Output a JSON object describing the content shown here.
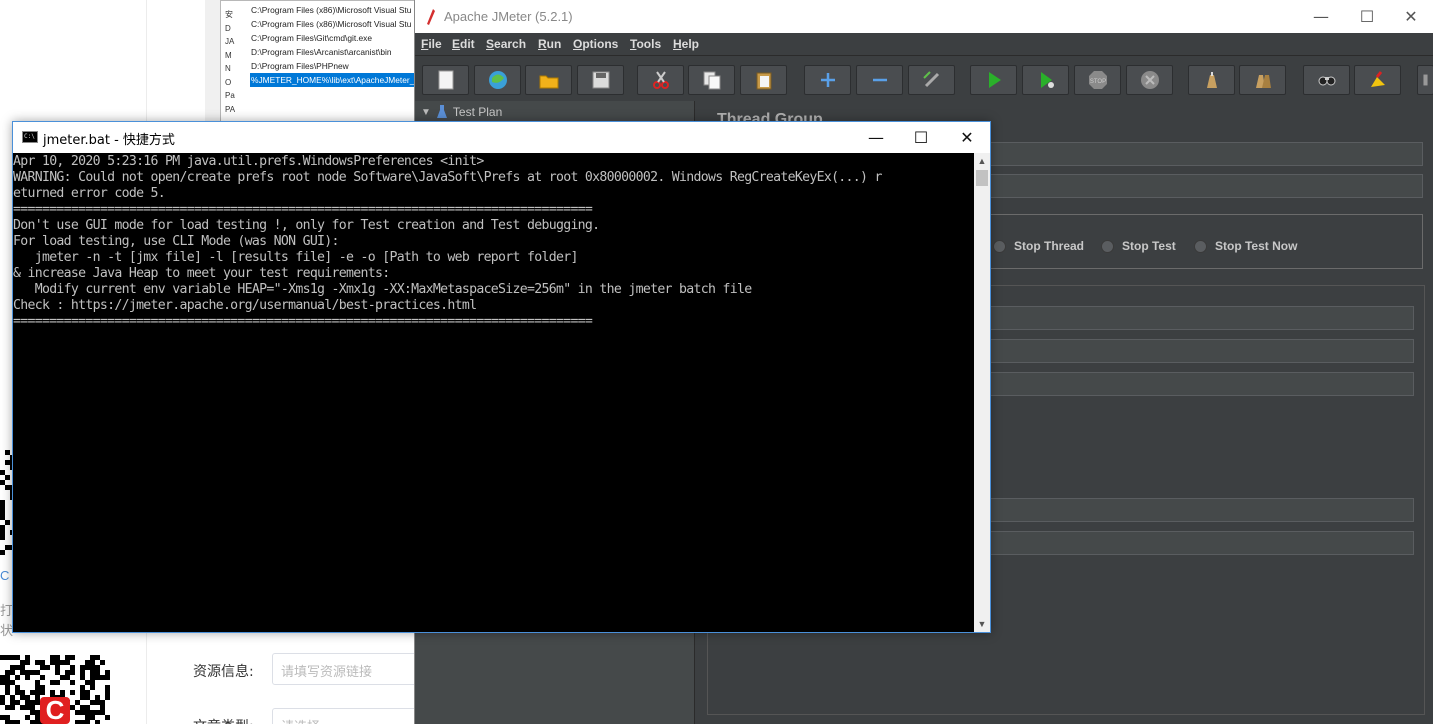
{
  "background_page": {
    "side_text_1": "C",
    "side_text_2": "打",
    "side_text_3": "状",
    "resource_label": "资源信息:",
    "resource_placeholder": "请填写资源链接",
    "article_type_label": "文章类型:",
    "article_type_placeholder": "请选择"
  },
  "path_dialog": {
    "left_labels": [
      "安",
      "D",
      "JA",
      "M",
      "N",
      "O",
      "Pa",
      "PA"
    ],
    "paths": [
      "C:\\Program Files (x86)\\Microsoft Visual Stu",
      "C:\\Program Files (x86)\\Microsoft Visual Stu",
      "C:\\Program Files\\Git\\cmd\\git.exe",
      "D:\\Program Files\\Arcanist\\arcanist\\bin",
      "D:\\Program Files\\PHPnew",
      "%JMETER_HOME%\\lib\\ext\\ApacheJMeter_c"
    ],
    "selected_index": 5
  },
  "jmeter": {
    "title": "Apache JMeter (5.2.1)",
    "menu": [
      "File",
      "Edit",
      "Search",
      "Run",
      "Options",
      "Tools",
      "Help"
    ],
    "menu_underline": [
      "F",
      "E",
      "S",
      "R",
      "O",
      "T",
      "H"
    ],
    "toolbar_icons": [
      "new-icon",
      "templates-icon",
      "open-icon",
      "save-icon",
      "cut-icon",
      "copy-icon",
      "paste-icon",
      "expand-icon",
      "collapse-icon",
      "toggle-icon",
      "start-icon",
      "start-no-pauses-icon",
      "stop-icon",
      "shutdown-icon",
      "clear-icon",
      "clear-all-icon",
      "search-icon",
      "reset-search-icon",
      "function-helper-icon"
    ],
    "tree": {
      "root_label": "Test Plan"
    },
    "panel_title": "Thread Group",
    "action_options": [
      "Stop Thread",
      "Stop Test",
      "Stop Test Now"
    ]
  },
  "cmd": {
    "title": "jmeter.bat - 快捷方式",
    "icon_text": "C:\\",
    "lines": [
      "Apr 10, 2020 5:23:16 PM java.util.prefs.WindowsPreferences <init>",
      "WARNING: Could not open/create prefs root node Software\\JavaSoft\\Prefs at root 0x80000002. Windows RegCreateKeyEx(...) r",
      "eturned error code 5.",
      "================================================================================",
      "Don't use GUI mode for load testing !, only for Test creation and Test debugging.",
      "For load testing, use CLI Mode (was NON GUI):",
      "   jmeter -n -t [jmx file] -l [results file] -e -o [Path to web report folder]",
      "& increase Java Heap to meet your test requirements:",
      "   Modify current env variable HEAP=\"-Xms1g -Xmx1g -XX:MaxMetaspaceSize=256m\" in the jmeter batch file",
      "Check : https://jmeter.apache.org/usermanual/best-practices.html",
      "================================================================================"
    ]
  },
  "colors": {
    "cmd_text": "#c0c0c0",
    "cmd_bg": "#000000",
    "jmeter_dark": "#3c3f41",
    "selection_blue": "#0078d7"
  }
}
